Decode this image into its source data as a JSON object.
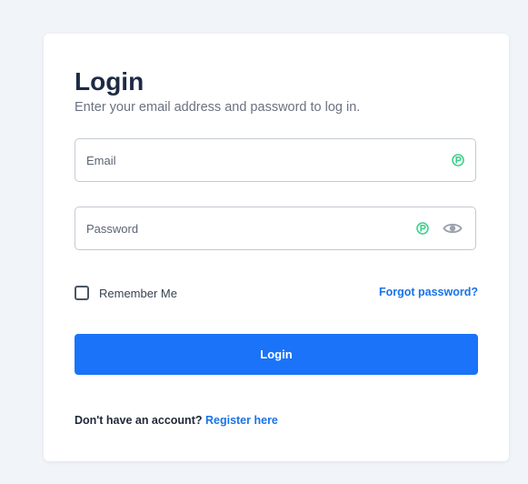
{
  "login": {
    "title": "Login",
    "subtitle": "Enter your email address and password to log in.",
    "email": {
      "value": "",
      "placeholder": "Email"
    },
    "password": {
      "value": "",
      "placeholder": "Password"
    },
    "remember_label": "Remember Me",
    "remember_checked": false,
    "forgot_label": "Forgot password?",
    "submit_label": "Login",
    "register_prompt": "Don't have an account?",
    "register_link": "Register here"
  },
  "icons": {
    "password_manager": "password-manager-icon",
    "show_password": "eye-icon"
  },
  "colors": {
    "background": "#f1f5f9",
    "card": "#ffffff",
    "title": "#1e2a44",
    "primary": "#1a73f8",
    "link": "#1a73e8",
    "password_manager_icon": "#3ecf8e"
  }
}
